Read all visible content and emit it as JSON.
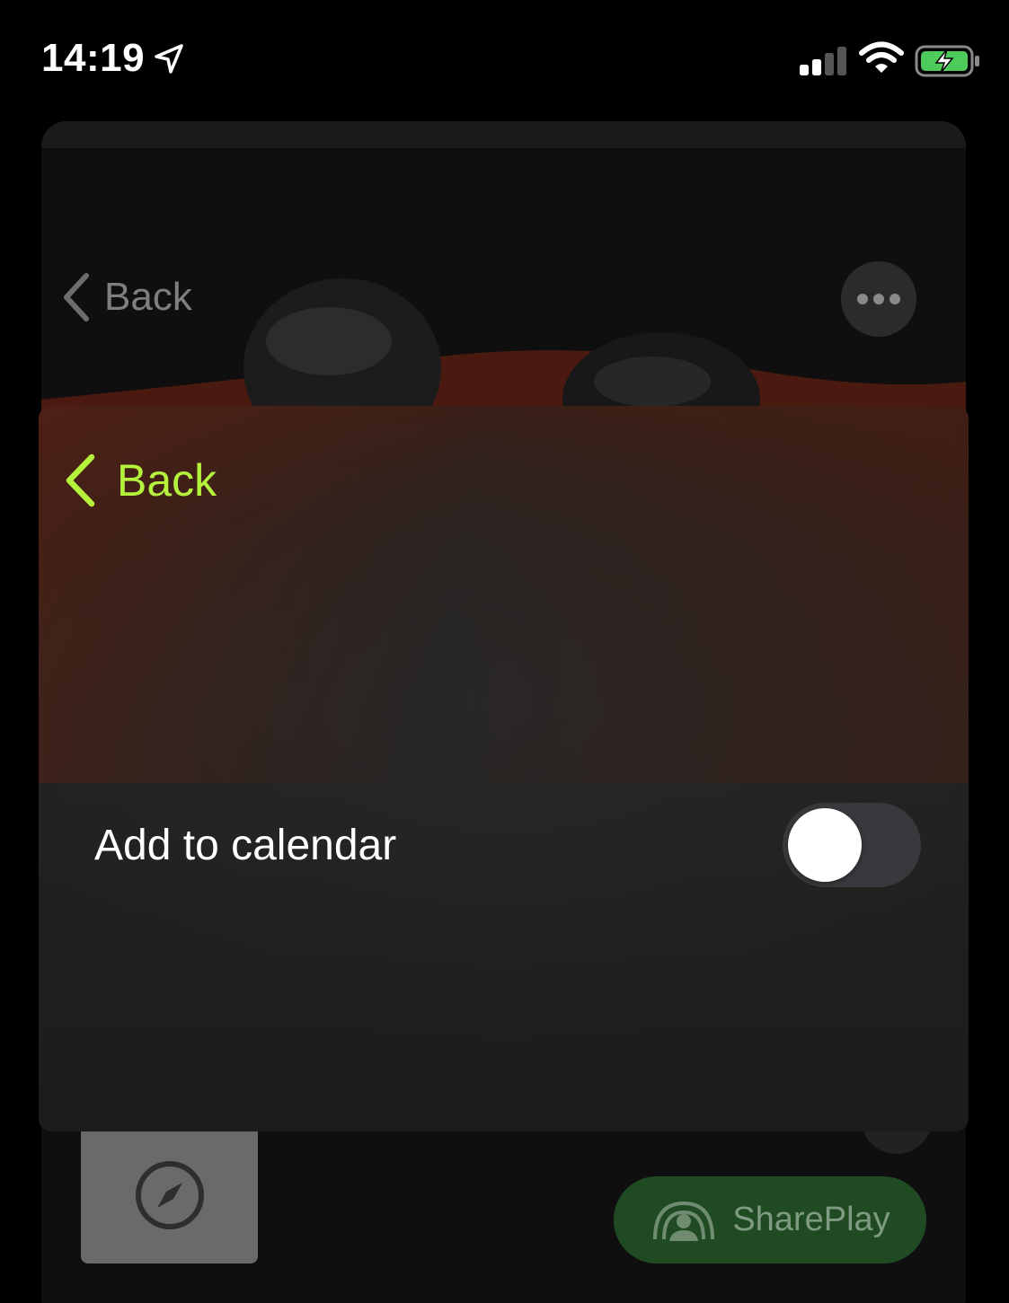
{
  "status_bar": {
    "time": "14:19"
  },
  "background_screen": {
    "back_label": "Back",
    "shareplay_label": "SharePlay"
  },
  "modal": {
    "back_label": "Back",
    "toggle_label": "Add to calendar",
    "toggle_on": false
  },
  "colors": {
    "accent": "#b5f23c",
    "shareplay_bg": "#1f4a22",
    "toggle_off": "#38393c"
  },
  "icons": {
    "location": "location-arrow-icon",
    "signal": "cellular-signal-icon",
    "wifi": "wifi-icon",
    "battery": "battery-charging-icon",
    "back": "chevron-left-icon",
    "more": "ellipsis-icon",
    "compass": "compass-icon",
    "shareplay": "shareplay-icon"
  }
}
